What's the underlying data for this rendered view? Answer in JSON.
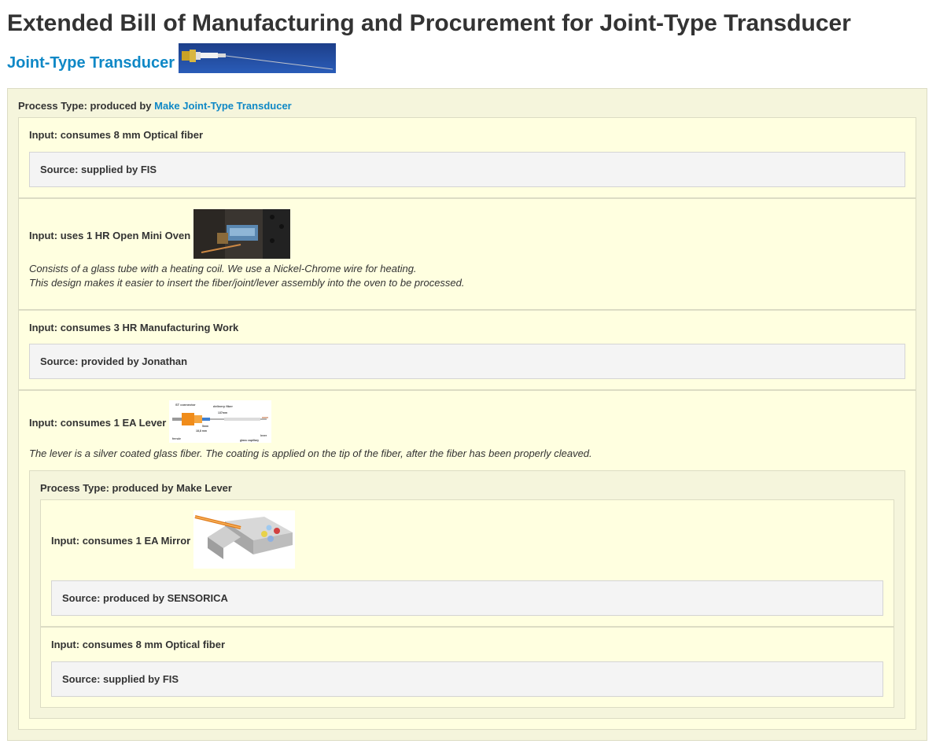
{
  "page": {
    "heading": "Extended Bill of Manufacturing and Procurement for Joint-Type Transducer",
    "product_link": "Joint-Type Transducer"
  },
  "root": {
    "process_prefix": "Process Type: produced by ",
    "process_link": "Make Joint-Type Transducer",
    "inputs": [
      {
        "label": "Input: consumes 8 mm Optical fiber",
        "source": "Source: supplied by FIS"
      },
      {
        "label": "Input: uses 1 HR Open Mini Oven",
        "desc_line1": "Consists of a glass tube with a heating coil. We use a Nickel-Chrome wire for heating.",
        "desc_line2": "This design makes it easier to insert the fiber/joint/lever assembly into the oven to be processed."
      },
      {
        "label": "Input: consumes 3 HR Manufacturing Work",
        "source": "Source: provided by Jonathan"
      },
      {
        "label": "Input: consumes 1 EA Lever",
        "desc": "The lever is a silver coated glass fiber. The coating is applied on the tip of the fiber, after the fiber has been properly cleaved.",
        "sub_process": "Process Type: produced by Make Lever",
        "sub_inputs": [
          {
            "label": "Input: consumes 1 EA Mirror",
            "source": "Source: produced by SENSORICA"
          },
          {
            "label": "Input: consumes 8 mm Optical fiber",
            "source": "Source: supplied by FIS"
          }
        ]
      }
    ]
  },
  "diagram_text": {
    "st_connector": "ST connector",
    "delivery_fiber": "delivery fiber",
    "ferrule": "ferrule",
    "glass_capillary": "glass capillary",
    "lever": "lever",
    "dim_137": "137mm",
    "dim_5": "5mm",
    "dim_18": "18,8 mm"
  },
  "colors": {
    "link": "#0f88c6",
    "process_bg": "#f5f5dc",
    "input_bg": "#ffffe0",
    "source_bg": "#f4f4f4"
  }
}
